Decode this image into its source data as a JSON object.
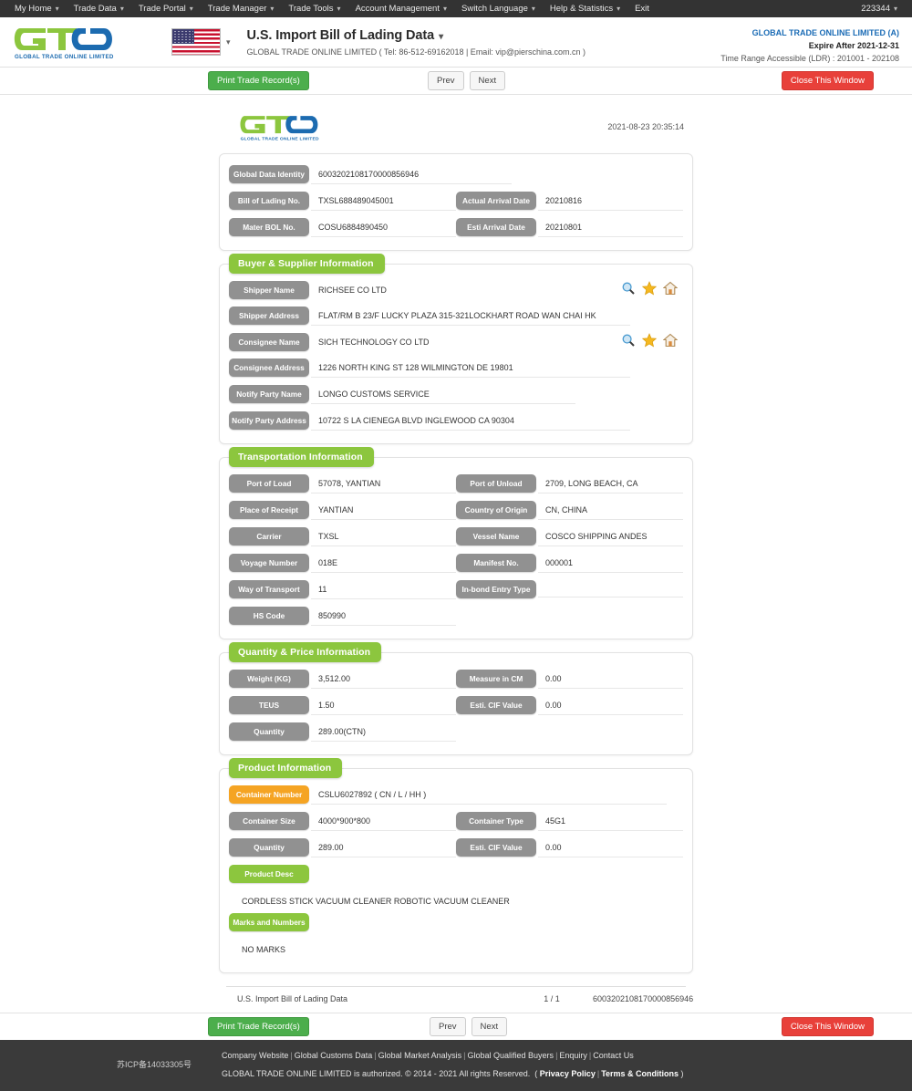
{
  "topnav": {
    "items": [
      {
        "label": "My Home",
        "caret": true
      },
      {
        "label": "Trade Data",
        "caret": true
      },
      {
        "label": "Trade Portal",
        "caret": true
      },
      {
        "label": "Trade Manager",
        "caret": true
      },
      {
        "label": "Trade Tools",
        "caret": true
      },
      {
        "label": "Account Management",
        "caret": true
      },
      {
        "label": "Switch Language",
        "caret": true
      },
      {
        "label": "Help & Statistics",
        "caret": true
      },
      {
        "label": "Exit",
        "caret": false
      }
    ],
    "user": "223344"
  },
  "header": {
    "logo_text": "GLOBAL TRADE ONLINE LIMITED",
    "flag": "us-flag-icon",
    "title": "U.S. Import Bill of Lading Data",
    "subtitle": "GLOBAL TRADE ONLINE LIMITED ( Tel: 86-512-69162018 | Email: vip@pierschina.com.cn )",
    "company": "GLOBAL TRADE ONLINE LIMITED (A)",
    "expire": "Expire After 2021-12-31",
    "ldr": "Time Range Accessible (LDR) : 201001 - 202108"
  },
  "toolbar": {
    "print_label": "Print Trade Record(s)",
    "prev_label": "Prev",
    "next_label": "Next",
    "close_label": "Close This Window"
  },
  "document": {
    "timestamp": "2021-08-23 20:35:14",
    "identity": {
      "global_data_identity_label": "Global Data Identity",
      "global_data_identity_value": "6003202108170000856946",
      "bill_of_lading_label": "Bill of Lading No.",
      "bill_of_lading_value": "TXSL688489045001",
      "actual_arrival_label": "Actual Arrival Date",
      "actual_arrival_value": "20210816",
      "master_bol_label": "Mater BOL No.",
      "master_bol_value": "COSU6884890450",
      "esti_arrival_label": "Esti Arrival Date",
      "esti_arrival_value": "20210801"
    },
    "buyer_supplier": {
      "title": "Buyer & Supplier Information",
      "shipper_name_label": "Shipper Name",
      "shipper_name_value": "RICHSEE CO LTD",
      "shipper_address_label": "Shipper Address",
      "shipper_address_value": "FLAT/RM B 23/F LUCKY PLAZA 315-321LOCKHART ROAD WAN CHAI HK",
      "consignee_name_label": "Consignee Name",
      "consignee_name_value": "SICH TECHNOLOGY CO LTD",
      "consignee_address_label": "Consignee Address",
      "consignee_address_value": "1226 NORTH KING ST 128 WILMINGTON DE 19801",
      "notify_party_name_label": "Notify Party Name",
      "notify_party_name_value": "LONGO CUSTOMS SERVICE",
      "notify_party_address_label": "Notify Party Address",
      "notify_party_address_value": "10722 S LA CIENEGA BLVD INGLEWOOD CA 90304"
    },
    "transportation": {
      "title": "Transportation Information",
      "port_of_load_label": "Port of Load",
      "port_of_load_value": "57078, YANTIAN",
      "port_of_unload_label": "Port of Unload",
      "port_of_unload_value": "2709, LONG BEACH, CA",
      "place_of_receipt_label": "Place of Receipt",
      "place_of_receipt_value": "YANTIAN",
      "country_of_origin_label": "Country of Origin",
      "country_of_origin_value": "CN, CHINA",
      "carrier_label": "Carrier",
      "carrier_value": "TXSL",
      "vessel_name_label": "Vessel Name",
      "vessel_name_value": "COSCO SHIPPING ANDES",
      "voyage_number_label": "Voyage Number",
      "voyage_number_value": "018E",
      "manifest_no_label": "Manifest No.",
      "manifest_no_value": "000001",
      "way_of_transport_label": "Way of Transport",
      "way_of_transport_value": "11",
      "inbond_entry_type_label": "In-bond Entry Type",
      "inbond_entry_type_value": "",
      "hs_code_label": "HS Code",
      "hs_code_value": "850990"
    },
    "quantity_price": {
      "title": "Quantity & Price Information",
      "weight_label": "Weight (KG)",
      "weight_value": "3,512.00",
      "measure_label": "Measure in CM",
      "measure_value": "0.00",
      "teus_label": "TEUS",
      "teus_value": "1.50",
      "cif_label": "Esti. CIF Value",
      "cif_value": "0.00",
      "quantity_label": "Quantity",
      "quantity_value": "289.00(CTN)"
    },
    "product": {
      "title": "Product Information",
      "container_number_label": "Container Number",
      "container_number_value": "CSLU6027892 ( CN / L / HH )",
      "container_size_label": "Container Size",
      "container_size_value": "4000*900*800",
      "container_type_label": "Container Type",
      "container_type_value": "45G1",
      "quantity_label": "Quantity",
      "quantity_value": "289.00",
      "cif_label": "Esti. CIF Value",
      "cif_value": "0.00",
      "product_desc_label": "Product Desc",
      "product_desc_value": "CORDLESS STICK VACUUM CLEANER ROBOTIC VACUUM CLEANER",
      "marks_label": "Marks and Numbers",
      "marks_value": "NO MARKS"
    },
    "footer": {
      "name": "U.S. Import Bill of Lading Data",
      "page": "1 / 1",
      "identity": "6003202108170000856946"
    }
  },
  "page_footer": {
    "icp": "苏ICP备14033305号",
    "links": [
      "Company Website",
      "Global Customs Data",
      "Global Market Analysis",
      "Global Qualified Buyers",
      "Enquiry",
      "Contact Us"
    ],
    "copyright": "GLOBAL TRADE ONLINE LIMITED is authorized. © 2014 - 2021 All rights Reserved.",
    "privacy": "Privacy Policy",
    "terms": "Terms & Conditions"
  },
  "colors": {
    "accent_green": "#8cc63e",
    "label_gray": "#919191",
    "accent_orange": "#f5a423",
    "brand_blue": "#1a6bb5",
    "danger_red": "#e8403a",
    "success_green": "#4cae4c"
  }
}
